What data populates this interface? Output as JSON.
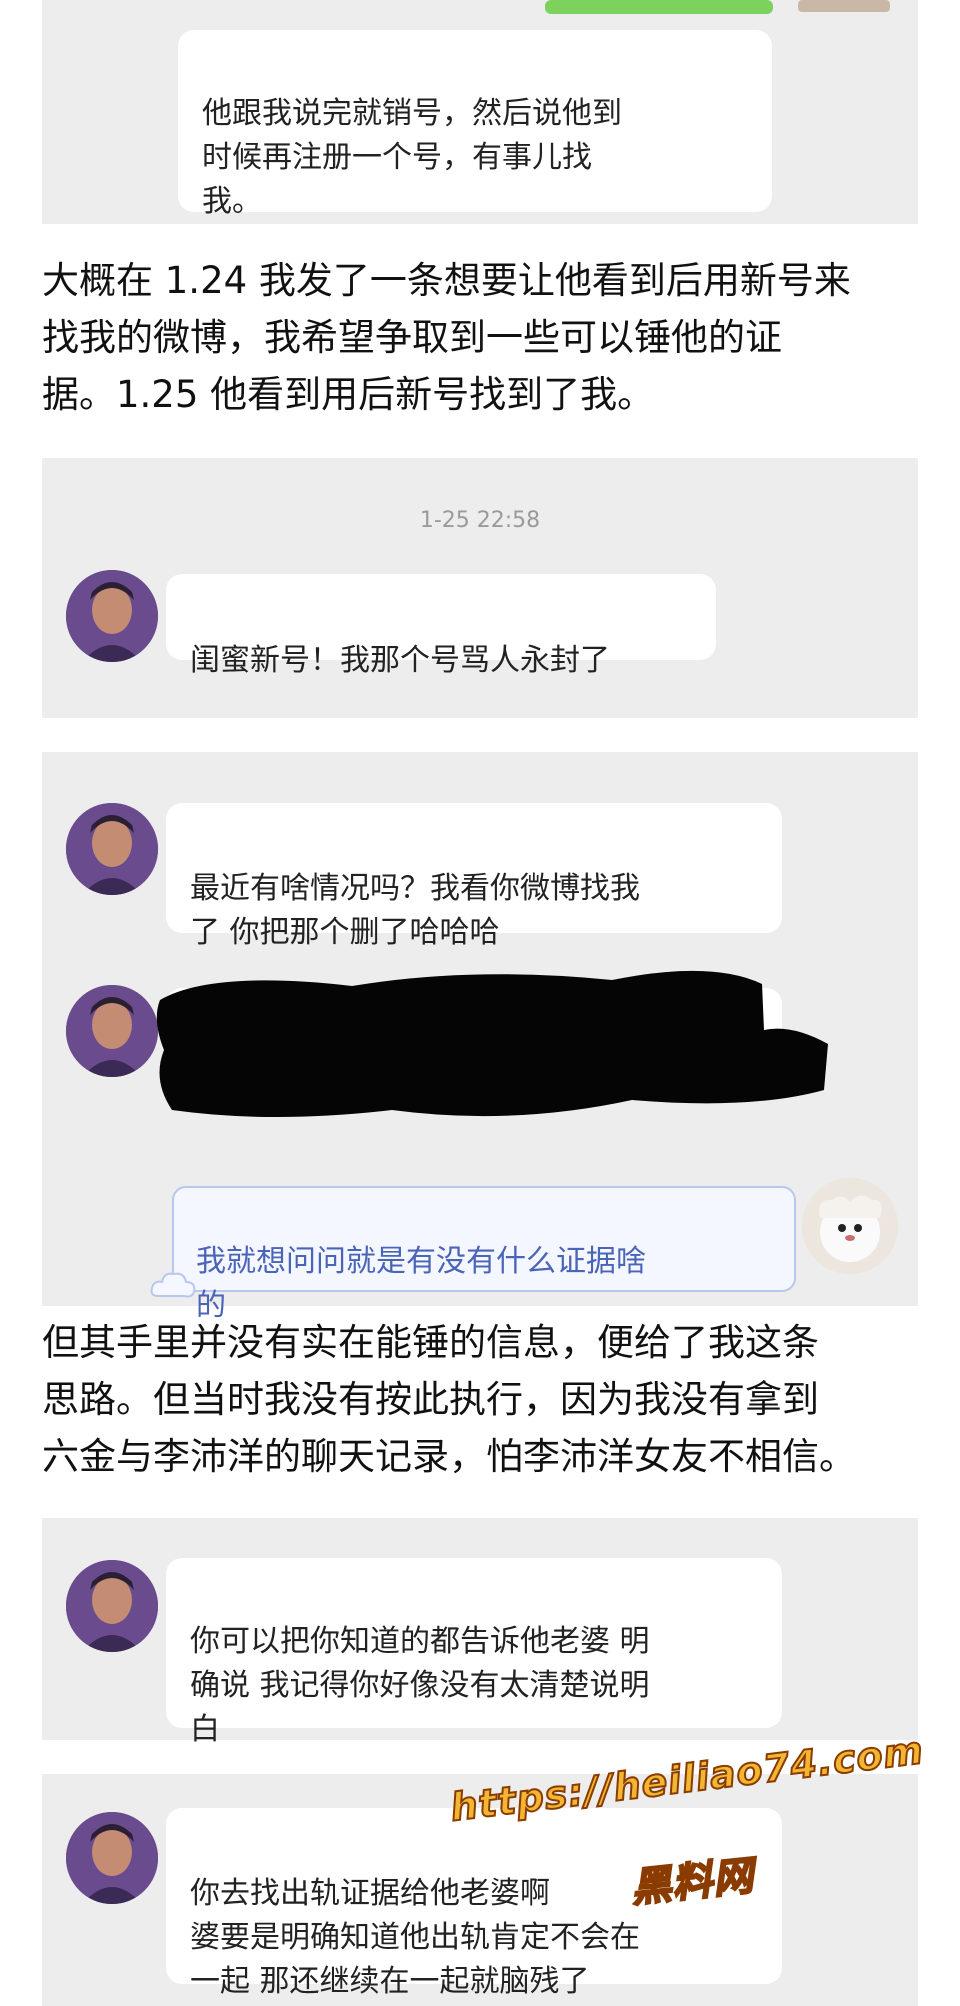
{
  "top_chat": {
    "message": "他跟我说完就销号，然后说他到\n时候再注册一个号，有事儿找\n我。"
  },
  "prose_1": "大概在 1.24 我发了一条想要让他看到后用新号来\n找我的微博，我希望争取到一些可以锤他的证\n据。1.25 他看到用后新号找到了我。",
  "chat_1": {
    "timestamp": "1-25 22:58",
    "message": "闺蜜新号！我那个号骂人永封了"
  },
  "chat_2": {
    "message_1": "最近有啥情况吗？我看你微博找我\n了 你把那个删了哈哈哈",
    "message_3": "我就想问问就是有没有什么证据啥\n的"
  },
  "prose_2": "但其手里并没有实在能锤的信息，便给了我这条\n思路。但当时我没有按此执行，因为我没有拿到\n六金与李沛洋的聊天记录，怕李沛洋女友不相信。",
  "chat_3": {
    "message": "你可以把你知道的都告诉他老婆 明\n确说 我记得你好像没有太清楚说明\n白"
  },
  "chat_4": {
    "message": "你去找出轨证据给他老婆啊\n婆要是明确知道他出轨肯定不会在\n一起 那还继续在一起就脑残了"
  },
  "watermark": {
    "url": "https://heiliao74.com",
    "name": "黑料网"
  },
  "colors": {
    "panel_bg": "#ededed",
    "bubble_bg": "#ffffff",
    "accent_green": "#7cd25c",
    "watermark_fill": "#f2b632"
  }
}
